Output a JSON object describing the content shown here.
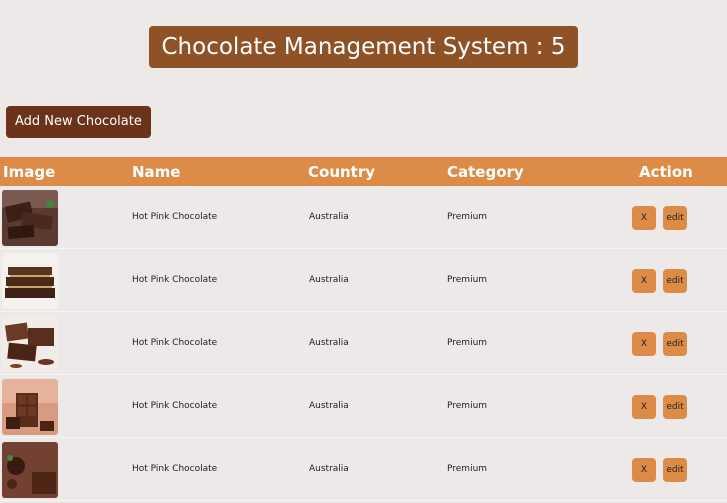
{
  "header": {
    "title": "Chocolate Management System : 5"
  },
  "toolbar": {
    "add_label": "Add New Chocolate"
  },
  "table": {
    "columns": [
      "Image",
      "Name",
      "Country",
      "Category",
      "Action"
    ],
    "rows": [
      {
        "name": "Hot Pink Chocolate",
        "country": "Australia",
        "category": "Premium",
        "delete_label": "X",
        "edit_label": "edit"
      },
      {
        "name": "Hot Pink Chocolate",
        "country": "Australia",
        "category": "Premium",
        "delete_label": "X",
        "edit_label": "edit"
      },
      {
        "name": "Hot Pink Chocolate",
        "country": "Australia",
        "category": "Premium",
        "delete_label": "X",
        "edit_label": "edit"
      },
      {
        "name": "Hot Pink Chocolate",
        "country": "Australia",
        "category": "Premium",
        "delete_label": "X",
        "edit_label": "edit"
      },
      {
        "name": "Hot Pink Chocolate",
        "country": "Australia",
        "category": "Premium",
        "delete_label": "X",
        "edit_label": "edit"
      }
    ]
  },
  "colors": {
    "background": "#ede9e8",
    "title_bg": "#8f5226",
    "add_button_bg": "#6b3319",
    "header_bg": "#dd8c48",
    "action_button_bg": "#dd8c48"
  }
}
